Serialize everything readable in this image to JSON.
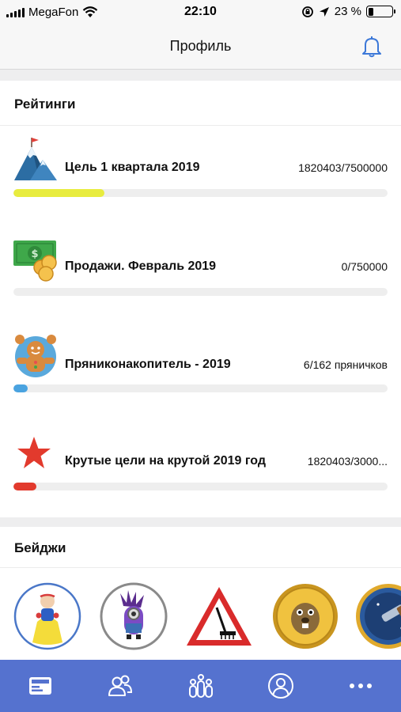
{
  "status_bar": {
    "carrier": "MegaFon",
    "time": "22:10",
    "battery": "23 %",
    "battery_level": 0.23
  },
  "header": {
    "title": "Профиль",
    "notifications_icon": "bell-icon"
  },
  "ratings": {
    "title": "Рейтинги",
    "items": [
      {
        "icon": "mountain-flag-icon",
        "name": "Цель 1 квартала 2019",
        "value": "1820403/7500000",
        "progress": 0.243,
        "color": "#e8ec3f"
      },
      {
        "icon": "money-coins-icon",
        "name": "Продажи. Февраль 2019",
        "value": "0/750000",
        "progress": 0.0,
        "color": "#cfd3d8"
      },
      {
        "icon": "gingerbread-man-icon",
        "name": "Пряниконакопитель - 2019",
        "value": "6/162 пряничков",
        "progress": 0.037,
        "color": "#4aa3e0"
      },
      {
        "icon": "red-star-icon",
        "name": "Крутые цели на крутой 2019 год",
        "value": "1820403/3000...",
        "progress": 0.061,
        "color": "#e23a2d"
      }
    ]
  },
  "badges": {
    "title": "Бейджи",
    "items": [
      {
        "icon": "princess-badge"
      },
      {
        "icon": "purple-minion-badge"
      },
      {
        "icon": "road-work-sign-badge"
      },
      {
        "icon": "gold-coin-beaver-badge"
      },
      {
        "icon": "telescope-badge"
      }
    ]
  },
  "tab_bar": {
    "tabs": [
      {
        "icon": "feed-card-icon",
        "active": true
      },
      {
        "icon": "users-icon",
        "active": false
      },
      {
        "icon": "team-icon",
        "active": false
      },
      {
        "icon": "profile-icon",
        "active": false
      },
      {
        "icon": "more-icon",
        "active": false
      }
    ]
  }
}
